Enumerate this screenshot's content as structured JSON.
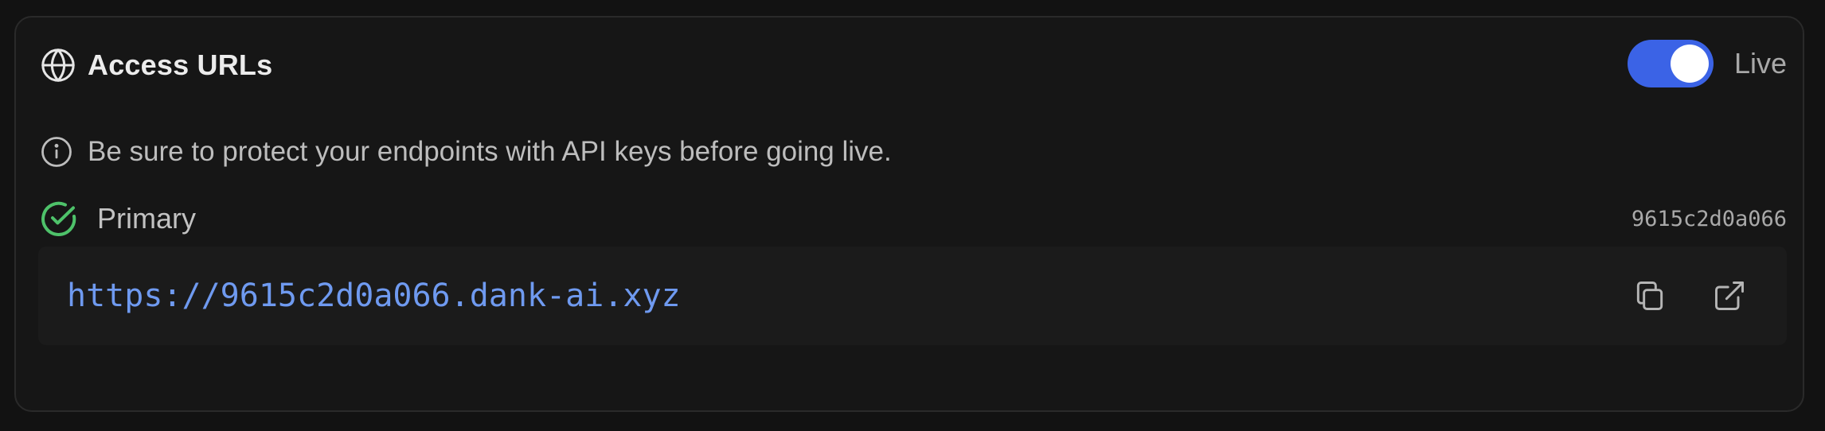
{
  "section": {
    "title": "Access URLs",
    "icon": "globe-icon"
  },
  "live_toggle": {
    "label": "Live",
    "enabled": true,
    "color": "#3b63e6"
  },
  "notice": {
    "icon": "info-icon",
    "text": "Be sure to protect your endpoints with API keys before going live."
  },
  "primary": {
    "label": "Primary",
    "status_icon": "check-circle-icon",
    "status_color": "#4ec26a",
    "id": "9615c2d0a066",
    "url": "https://9615c2d0a066.dank-ai.xyz",
    "url_color": "#6f9af0",
    "actions": {
      "copy_icon": "copy-icon",
      "open_icon": "external-link-icon"
    }
  }
}
